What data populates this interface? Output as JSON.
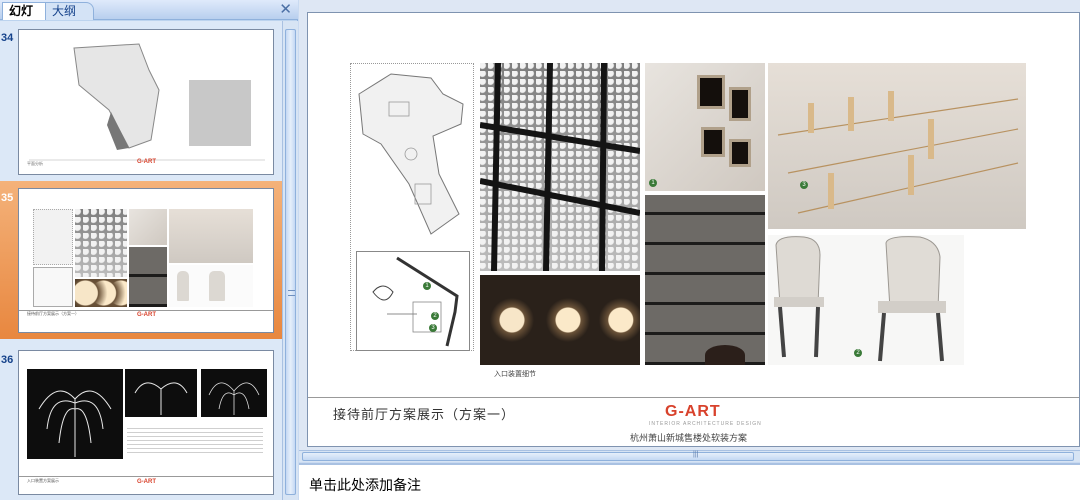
{
  "pane": {
    "tabs": [
      {
        "label": "幻灯片"
      },
      {
        "label": "大纲"
      }
    ],
    "close_glyph": "✕"
  },
  "thumbnails": [
    {
      "number": "34",
      "title": "平面分析",
      "logo": "G-ART"
    },
    {
      "number": "35",
      "title": "接待前厅方案展示（方案一）",
      "logo": "G-ART"
    },
    {
      "number": "36",
      "title": "入口装置方案展示",
      "logo": "G-ART"
    }
  ],
  "slide": {
    "title": "接待前厅方案展示（方案一）",
    "logo": "G-ART",
    "logo_sub": "INTERIOR ARCHITECTURE DESIGN",
    "footer": "杭州萧山新城售楼处软装方案",
    "caption": "入口装置细节",
    "badges": [
      "1",
      "2",
      "3"
    ]
  },
  "notes": {
    "placeholder": "单击此处添加备注"
  },
  "colors": {
    "selected_thumb": "#e8873f",
    "pane_bg": "#bcd3ee",
    "logo_red": "#d8422c"
  }
}
